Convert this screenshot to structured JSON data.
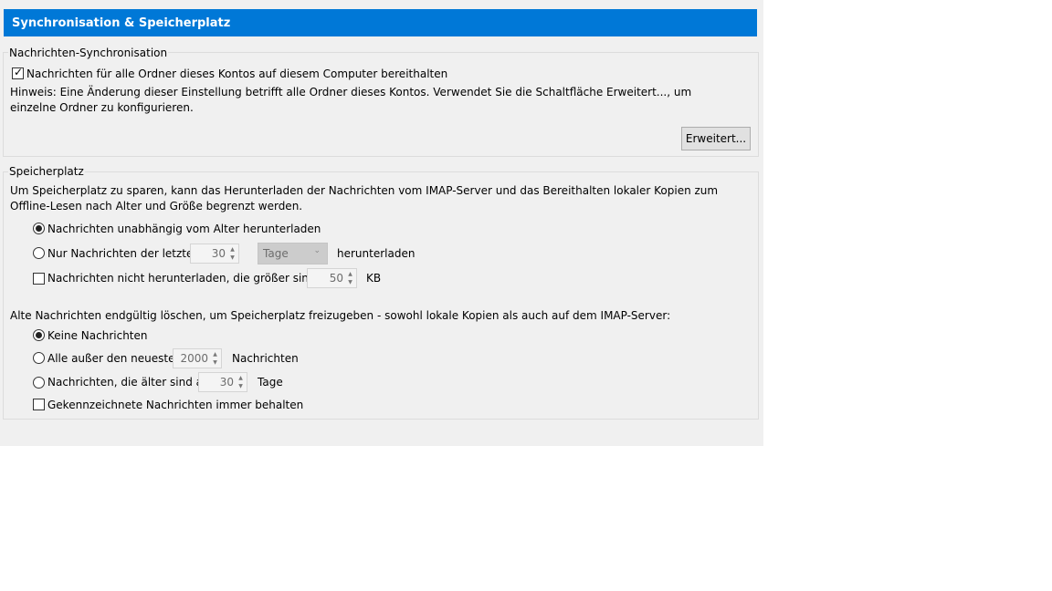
{
  "header": {
    "title": "Synchronisation & Speicherplatz"
  },
  "sync": {
    "legend": "Nachrichten-Synchronisation",
    "keep_local": {
      "label": "Nachrichten für alle Ordner dieses Kontos auf diesem Computer bereithalten",
      "checked": true
    },
    "hint": "Hinweis: Eine Änderung dieser Einstellung betrifft alle Ordner dieses Kontos. Verwendet Sie die Schaltfläche Erweitert..., um einzelne Ordner zu konfigurieren.",
    "advanced_button": "Erweitert..."
  },
  "storage": {
    "legend": "Speicherplatz",
    "intro": "Um Speicherplatz zu sparen, kann das Herunterladen der Nachrichten vom IMAP-Server und das Bereithalten lokaler Kopien zum Offline-Lesen nach Alter und Größe begrenzt werden.",
    "download_all": {
      "label": "Nachrichten unabhängig vom Alter herunterladen",
      "selected": true
    },
    "download_recent": {
      "label": "Nur Nachrichten der letzten",
      "value": "30",
      "unit": "Tage",
      "suffix": "herunterladen",
      "selected": false
    },
    "size_limit": {
      "label": "Nachrichten nicht herunterladen, die größer sind als",
      "value": "50",
      "unit": "KB",
      "checked": false
    },
    "delete_intro": "Alte Nachrichten endgültig löschen, um Speicherplatz freizugeben - sowohl lokale Kopien als auch auf dem IMAP-Server:",
    "keep_none": {
      "label": "Keine Nachrichten",
      "selected": true
    },
    "keep_newest": {
      "label": "Alle außer den neuesten",
      "value": "2000",
      "suffix": "Nachrichten",
      "selected": false
    },
    "older_than": {
      "label": "Nachrichten, die älter sind als",
      "value": "30",
      "suffix": "Tage",
      "selected": false
    },
    "keep_flagged": {
      "label": "Gekennzeichnete Nachrichten immer behalten",
      "checked": false
    }
  }
}
